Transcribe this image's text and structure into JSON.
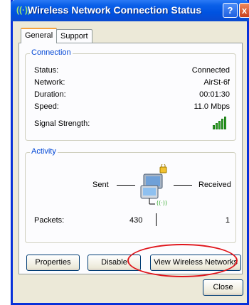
{
  "window": {
    "title": "Wireless Network Connection Status",
    "title_icon": "wireless-signal-icon",
    "help_button": "?",
    "close_button": "x"
  },
  "tabs": [
    {
      "label": "General",
      "active": true
    },
    {
      "label": "Support",
      "active": false
    }
  ],
  "connection": {
    "group_label": "Connection",
    "rows": [
      {
        "label": "Status:",
        "value": "Connected"
      },
      {
        "label": "Network:",
        "value": "AirSt-6f"
      },
      {
        "label": "Duration:",
        "value": "00:01:30"
      },
      {
        "label": "Speed:",
        "value": "11.0 Mbps"
      }
    ],
    "signal_label": "Signal Strength:",
    "signal_icon": "signal-strength-bars-icon",
    "signal_level_of_5": 5
  },
  "activity": {
    "group_label": "Activity",
    "sent_label": "Sent",
    "received_label": "Received",
    "icon": "network-computer-icon",
    "packets_label": "Packets:",
    "packets_sent": "430",
    "packets_received": "1"
  },
  "buttons": {
    "properties": "Properties",
    "disable": "Disable",
    "view_wireless": "View Wireless Networks",
    "close": "Close"
  },
  "colors": {
    "titlebar": "#0052e0",
    "group_label": "#0046d5",
    "highlight": "#e0151b",
    "active_tab_accent": "#f5a33d"
  }
}
